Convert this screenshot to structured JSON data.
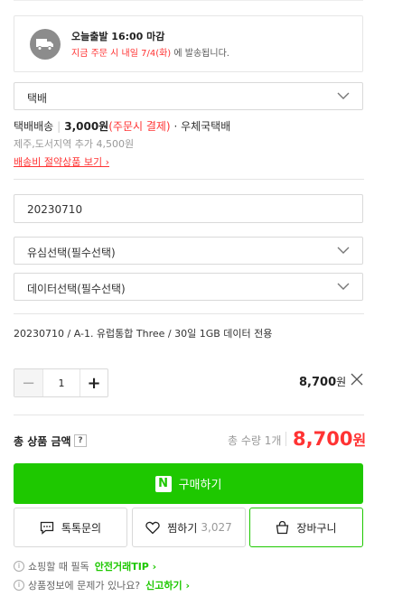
{
  "shipping": {
    "title": "오늘출발 16:00 마감",
    "sub_red": "지금 주문 시 내일 7/4(화)",
    "sub_rest": " 에 발송됩니다."
  },
  "delivery_select": {
    "value": "택배"
  },
  "delivery_info": {
    "method": "택배배송",
    "fee": "3,000원",
    "fee_note": "(주문시 결제)",
    "carrier": "· 우체국택배",
    "extra": "제주,도서지역 추가 4,500원",
    "saving_link": "배송비 절약상품 보기 ›"
  },
  "date_input": {
    "value": "20230710"
  },
  "usim_select": {
    "value": "유심선택(필수선택)"
  },
  "data_select": {
    "value": "데이터선택(필수선택)"
  },
  "selected_option": {
    "name": "20230710 / A-1. 유럽통합 Three / 30일 1GB 데이터 전용",
    "quantity": "1",
    "price": "8,700",
    "price_unit": "원"
  },
  "total": {
    "label": "총 상품 금액",
    "help": "?",
    "count": "총 수량 1개",
    "price": "8,700",
    "price_unit": "원"
  },
  "buttons": {
    "buy_icon": "N",
    "buy": "구매하기",
    "talk": "톡톡문의",
    "wish": "찜하기",
    "wish_count": "3,027",
    "cart": "장바구니"
  },
  "notices": {
    "safe_prefix": "쇼핑할 때 필독",
    "safe_link": "안전거래TIP ›",
    "report_prefix": "상품정보에 문제가 있나요?",
    "report_link": "신고하기 ›"
  },
  "colors": {
    "accent": "#1ec800",
    "price": "#ff3333"
  },
  "icons": [
    "truck-icon",
    "chevron-down-icon",
    "close-icon",
    "chat-icon",
    "heart-icon",
    "cart-icon",
    "info-icon"
  ]
}
